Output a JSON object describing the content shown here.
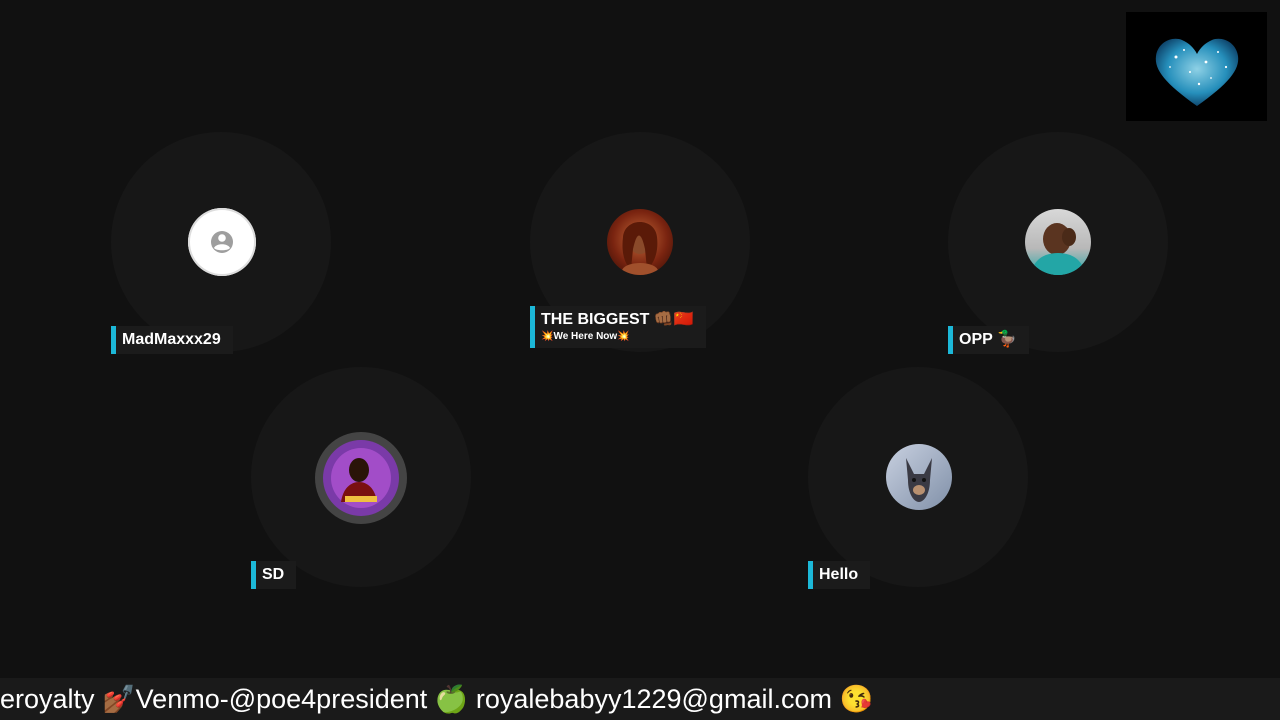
{
  "participants": [
    {
      "name": "MadMaxxx29",
      "avatar": "default-user-icon"
    },
    {
      "name": "THE BIGGEST 👊🏾🇨🇳",
      "subtitle": "💥We Here Now💥",
      "avatar": "woman-portrait-avatar"
    },
    {
      "name": "OPP 🦆",
      "avatar": "man-photo-avatar"
    },
    {
      "name": "SD",
      "avatar": "purple-logo-avatar"
    },
    {
      "name": "Hello",
      "avatar": "dog-photo-avatar"
    }
  ],
  "ticker": {
    "text": "eroyalty 💅🏾Venmo-@poe4president 🍏 royalebabyy1229@gmail.com 😘"
  },
  "preview": {
    "icon": "sparkle-heart-icon"
  },
  "colors": {
    "background": "#111111",
    "tile": "#171717",
    "accent": "#1cb8d8",
    "ticker_bg": "#1a1a1a"
  }
}
